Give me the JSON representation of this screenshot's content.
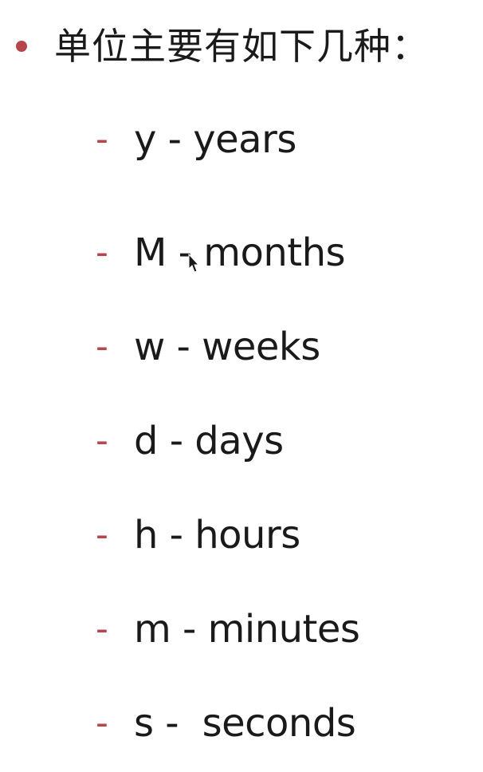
{
  "heading": {
    "text": "单位主要有如下几种："
  },
  "items": [
    {
      "dash": "-",
      "text": "y - years"
    },
    {
      "dash": "-",
      "text": "M - months"
    },
    {
      "dash": "-",
      "text": "w - weeks"
    },
    {
      "dash": "-",
      "text": "d - days"
    },
    {
      "dash": "-",
      "text": "h - hours"
    },
    {
      "dash": "-",
      "text": "m - minutes"
    },
    {
      "dash": "-",
      "text": "s -  seconds"
    }
  ],
  "colors": {
    "accent": "#b5474a",
    "text": "#1a1a1a",
    "background": "#ffffff"
  },
  "icons": {
    "bullet": "bullet-dot-icon",
    "cursor": "mouse-pointer-icon"
  }
}
